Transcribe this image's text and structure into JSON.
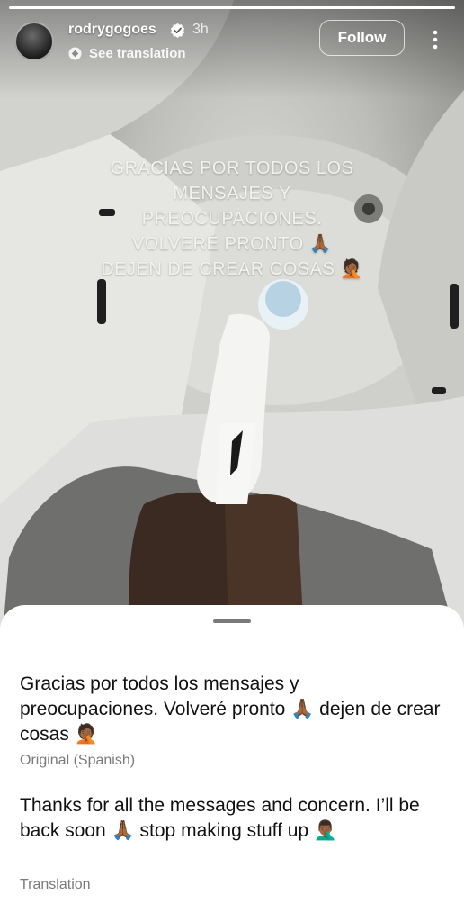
{
  "story": {
    "progress": 1.0,
    "author": {
      "username": "rodrygogoes",
      "verified": true,
      "timestamp": "3h"
    },
    "see_translation_label": "See translation",
    "follow_label": "Follow",
    "caption_lines": [
      "GRACIAS POR TODOS LOS",
      "MENSAJES Y",
      "PREOCUPACIONES.",
      "VOLVERÉ PRONTO 🙏🏾",
      "DEJEN DE CREAR COSAS 🤦🏾"
    ]
  },
  "translation_sheet": {
    "original_text": "Gracias por todos los mensajes y preocupaciones. Volveré pronto 🙏🏾 dejen de crear cosas 🤦🏾",
    "original_label": "Original (Spanish)",
    "translated_text": "Thanks for all the messages and concern. I’ll be back soon 🙏🏾 stop making stuff up 🤦🏾‍♂️",
    "translation_label": "Translation"
  },
  "colors": {
    "sheet_background": "#ffffff",
    "secondary_text": "#7a7a7a",
    "primary_text": "#111111"
  }
}
